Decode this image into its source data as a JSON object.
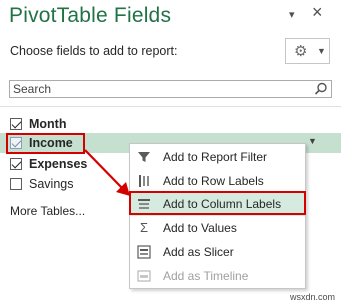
{
  "pane": {
    "title": "PivotTable Fields",
    "dropdown_glyph": "▾",
    "close_glyph": "×",
    "choose_label": "Choose fields to add to report:",
    "settings_icon": "gear-icon",
    "search_placeholder": "Search",
    "more_tables": "More Tables...",
    "accent_color": "#217346",
    "highlight_color": "#c6e0d0",
    "annotation_color": "#d40000"
  },
  "fields": [
    {
      "label": "Month",
      "checked": true,
      "bold": true
    },
    {
      "label": "Income",
      "checked": true,
      "bold": true,
      "highlighted": true
    },
    {
      "label": "Expenses",
      "checked": true,
      "bold": true
    },
    {
      "label": "Savings",
      "checked": false,
      "bold": false
    }
  ],
  "context_menu": {
    "items": [
      {
        "label": "Add to Report Filter",
        "icon": "filter-icon",
        "enabled": true
      },
      {
        "label": "Add to Row Labels",
        "icon": "row-labels-icon",
        "enabled": true
      },
      {
        "label": "Add to Column Labels",
        "icon": "column-labels-icon",
        "enabled": true,
        "selected": true
      },
      {
        "label": "Add to Values",
        "icon": "sigma-icon",
        "enabled": true
      },
      {
        "label": "Add as Slicer",
        "icon": "slicer-icon",
        "enabled": true
      },
      {
        "label": "Add as Timeline",
        "icon": "timeline-icon",
        "enabled": false
      }
    ]
  },
  "watermark": "wsxdn.com"
}
